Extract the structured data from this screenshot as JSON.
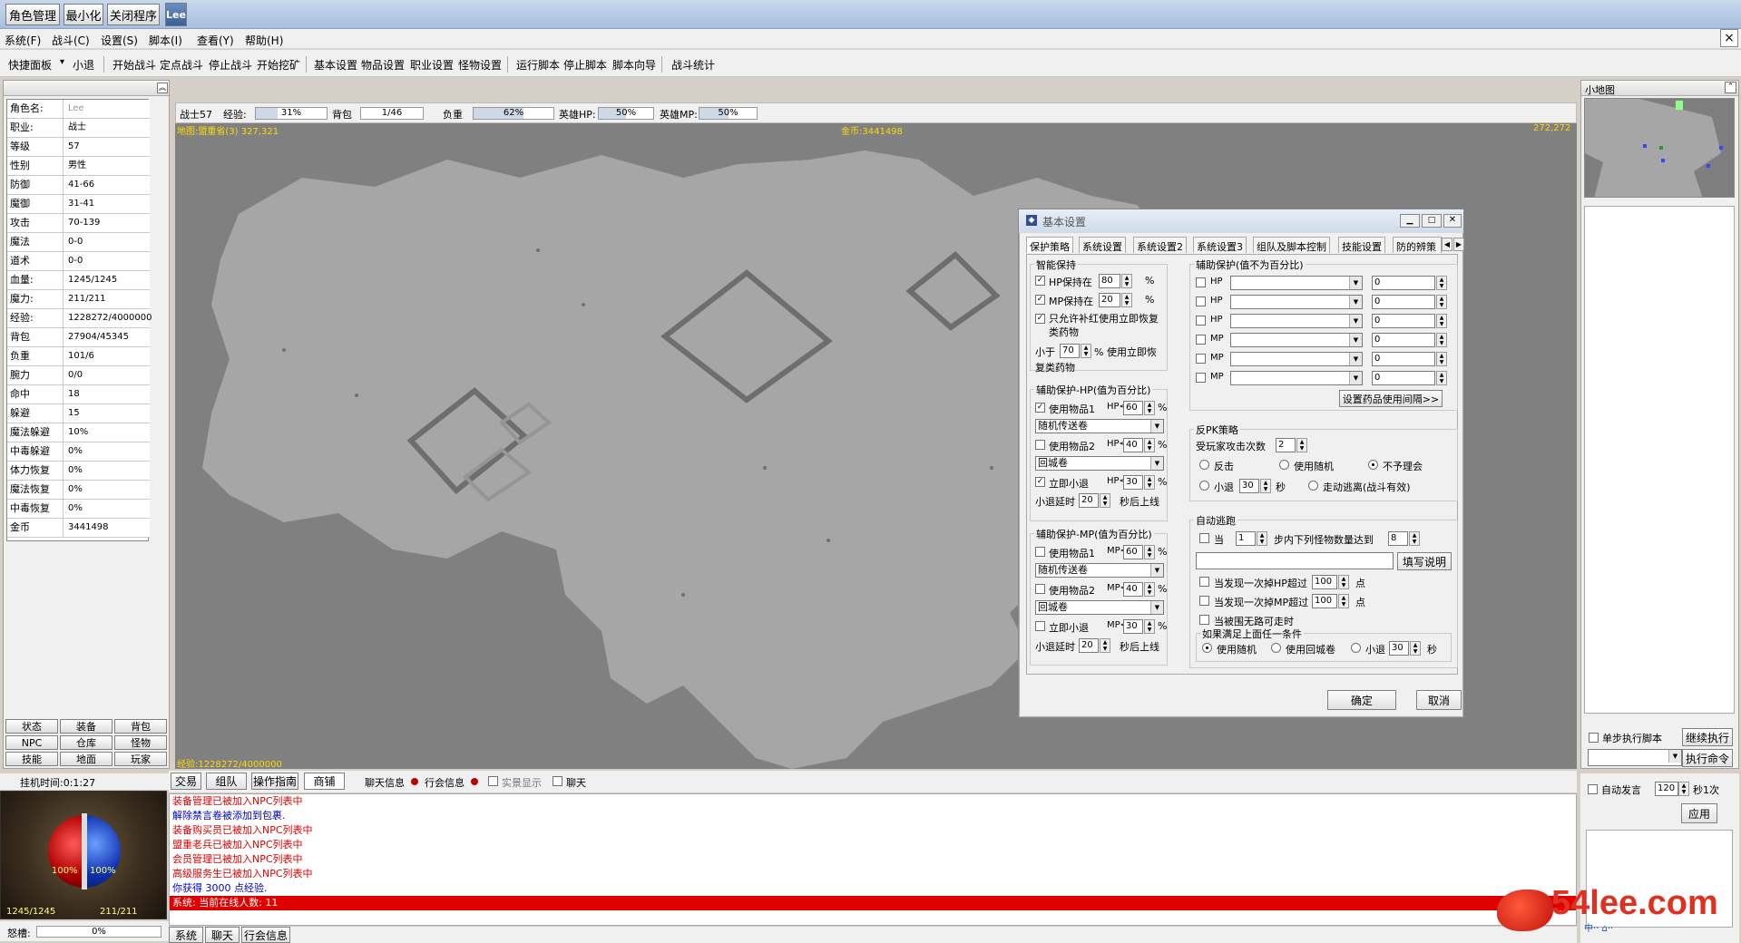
{
  "top": {
    "buttons": [
      "角色管理",
      "最小化",
      "关闭程序"
    ],
    "badge": "Lee"
  },
  "menu": {
    "items": [
      "系统(F)",
      "战斗(C)",
      "设置(S)",
      "脚本(I)",
      "查看(Y)",
      "帮助(H)"
    ],
    "close": "×"
  },
  "toolbar": {
    "panel": "快捷面板",
    "panel_arrow": "▾",
    "retreat": "小退",
    "items": [
      "开始战斗",
      "定点战斗",
      "停止战斗",
      "开始挖矿",
      "基本设置",
      "物品设置",
      "职业设置",
      "怪物设置",
      "运行脚本",
      "停止脚本",
      "脚本向导",
      "战斗统计"
    ]
  },
  "char": {
    "rows": [
      {
        "k": "角色名:",
        "v": "Lee"
      },
      {
        "k": "职业:",
        "v": "战士"
      },
      {
        "k": "等级",
        "v": "57"
      },
      {
        "k": "性别",
        "v": "男性"
      },
      {
        "k": "防御",
        "v": "41-66"
      },
      {
        "k": "魔御",
        "v": "31-41"
      },
      {
        "k": "攻击",
        "v": "70-139"
      },
      {
        "k": "魔法",
        "v": "0-0"
      },
      {
        "k": "道术",
        "v": "0-0"
      },
      {
        "k": "血量:",
        "v": "1245/1245"
      },
      {
        "k": "魔力:",
        "v": "211/211"
      },
      {
        "k": "经验:",
        "v": "1228272/4000000"
      },
      {
        "k": "背包",
        "v": "27904/45345"
      },
      {
        "k": "负重",
        "v": "101/6"
      },
      {
        "k": "腕力",
        "v": "0/0"
      },
      {
        "k": "命中",
        "v": "18"
      },
      {
        "k": "躲避",
        "v": "15"
      },
      {
        "k": "魔法躲避",
        "v": "10%"
      },
      {
        "k": "中毒躲避",
        "v": "0%"
      },
      {
        "k": "体力恢复",
        "v": "0%"
      },
      {
        "k": "魔法恢复",
        "v": "0%"
      },
      {
        "k": "中毒恢复",
        "v": "0%"
      },
      {
        "k": "金币",
        "v": "3441498"
      }
    ],
    "tabs": [
      "状态",
      "装备",
      "背包",
      "NPC",
      "仓库",
      "怪物",
      "技能",
      "地面",
      "玩家"
    ],
    "hang_time": "挂机时间:0:1:27",
    "hp_pct": "100%",
    "mp_pct": "100%",
    "hp": "1245/1245",
    "mp": "211/211",
    "rage_label": "怒槽:",
    "rage": "0%"
  },
  "status": {
    "name": "战士57",
    "exp_label": "经验:",
    "exp": "31%",
    "bag_label": "背包",
    "bag": "1/46",
    "load_label": "负重",
    "load": "62%",
    "hero_hp_label": "英雄HP:",
    "hero_hp": "50%",
    "hero_mp_label": "英雄MP:",
    "hero_mp": "50%",
    "map": "地图:盟重省(3) 327,321",
    "gold": "金币:3441498",
    "coord": "272,272",
    "exp_bottom": "经验:1228272/4000000",
    "progress": {
      "exp": 0.31,
      "load": 0.62,
      "hero_hp": 0.5,
      "hero_mp": 0.5
    }
  },
  "minimap": {
    "title": "小地图",
    "btn": "⌃"
  },
  "script": {
    "single": "单步执行脚本",
    "continue": "继续执行",
    "exec": "执行命令",
    "auto_say": "自动发言",
    "interval": "120",
    "unit": "秒1次",
    "apply": "应用"
  },
  "chat": {
    "tabs": [
      "交易",
      "组队",
      "操作指南",
      "商铺"
    ],
    "opts": [
      "聊天信息",
      "行会信息",
      "实景显示",
      "聊天"
    ],
    "lines": [
      {
        "t": "装备管理已被加入NPC列表中",
        "c": "#e00000"
      },
      {
        "t": "解除禁言卷被添加到包裹.",
        "c": "#0000d0"
      },
      {
        "t": "装备购买员已被加入NPC列表中",
        "c": "#e00000"
      },
      {
        "t": "盟重老兵已被加入NPC列表中",
        "c": "#e00000"
      },
      {
        "t": "会员管理已被加入NPC列表中",
        "c": "#e00000"
      },
      {
        "t": "高级服务生已被加入NPC列表中",
        "c": "#e00000"
      },
      {
        "t": "你获得 3000 点经验.",
        "c": "#0000d0"
      }
    ],
    "system_line": "系统: 当前在线人数: 11",
    "bottom_tabs": [
      "系统",
      "聊天",
      "行会信息"
    ]
  },
  "dialog": {
    "title": "基本设置",
    "tabs": [
      "保护策略",
      "系统设置",
      "系统设置2",
      "系统设置3",
      "组队及脚本控制",
      "技能设置",
      "防的辨策"
    ],
    "smart_keep": "智能保持",
    "hp_keep": "HP保持在",
    "hp_keep_val": "80",
    "mp_keep": "MP保持在",
    "mp_keep_val": "20",
    "pct": "%",
    "only_red": "只允许补红使用立即恢复类药物",
    "less_than": "小于",
    "less_val": "70",
    "use_now": "% 使用立即恢复类药物",
    "aux_hp_title": "辅助保护-HP(值为百分比)",
    "aux_mp_title": "辅助保护-MP(值为百分比)",
    "use_item1": "使用物品1",
    "use_item2": "使用物品2",
    "instant_retreat": "立即小退",
    "retreat_delay": "小退延时",
    "sec_online": "秒后上线",
    "hp_lbl": "HP<",
    "mp_lbl": "MP<",
    "hp_item1": "60",
    "hp_sel1": "随机传送卷",
    "hp_item2": "40",
    "hp_sel2": "回城卷",
    "hp_retreat": "30",
    "hp_delay": "20",
    "mp_item1": "60",
    "mp_sel1": "随机传送卷",
    "mp_item2": "40",
    "mp_sel2": "回城卷",
    "mp_retreat": "30",
    "mp_delay": "20",
    "aux_title": "辅助保护(值不为百分比)",
    "aux_rows": [
      "HP",
      "HP",
      "HP",
      "MP",
      "MP",
      "MP"
    ],
    "aux_val": "0",
    "set_interval": "设置药品使用间隔>>",
    "anti_pk": "反PK策略",
    "attacked": "受玩家攻击次数",
    "attacked_val": "2",
    "fight_back": "反击",
    "use_random": "使用随机",
    "ignore": "不予理会",
    "retreat": "小退",
    "retreat_val": "30",
    "sec": "秒",
    "escape": "走动逃离(战斗有效)",
    "auto_escape": "自动逃跑",
    "when": "当",
    "when_val": "1",
    "steps": "步内下列怪物数量达到",
    "steps_val": "8",
    "write_desc": "填写说明",
    "found_hp": "当发现一次掉HP超过",
    "found_hp_val": "100",
    "found_mp": "当发现一次掉MP超过",
    "found_mp_val": "100",
    "points": "点",
    "no_path": "当被围无路可走时",
    "if_any": "如果满足上面任一条件",
    "use_random2": "使用随机",
    "use_home": "使用回城卷",
    "retreat2": "小退",
    "retreat2_val": "30",
    "sec2": "秒",
    "ok": "确定",
    "cancel": "取消"
  },
  "watermark": {
    "text": "54lee.com",
    "sub": "中·· ⌂··"
  }
}
